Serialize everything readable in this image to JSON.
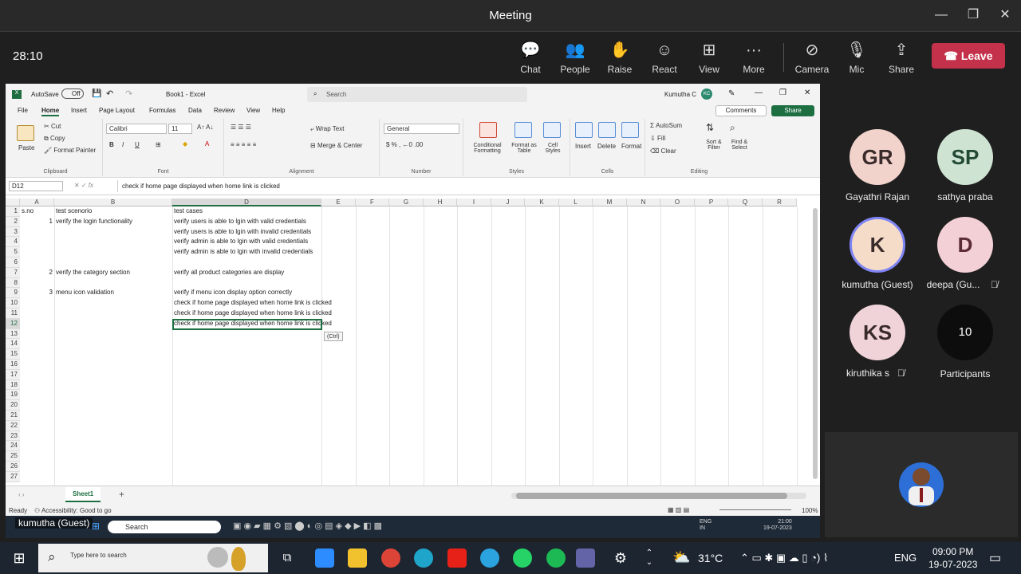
{
  "meeting": {
    "title": "Meeting",
    "timer": "28:10",
    "controls": [
      {
        "label": "Chat",
        "icon": "chat-icon"
      },
      {
        "label": "People",
        "icon": "people-icon"
      },
      {
        "label": "Raise",
        "icon": "raise-hand-icon"
      },
      {
        "label": "React",
        "icon": "react-icon"
      },
      {
        "label": "View",
        "icon": "view-icon"
      },
      {
        "label": "More",
        "icon": "more-icon"
      },
      {
        "label": "Camera",
        "icon": "camera-off-icon"
      },
      {
        "label": "Mic",
        "icon": "mic-off-icon"
      },
      {
        "label": "Share",
        "icon": "share-icon"
      }
    ],
    "leave_label": "Leave",
    "leave_color": "#c4314b"
  },
  "excel": {
    "autosave_label": "AutoSave",
    "autosave_state": "Off",
    "filename": "Book1 - Excel",
    "search_placeholder": "Search",
    "user_name": "Kumutha C",
    "user_initials": "KC",
    "menu": [
      "File",
      "Home",
      "Insert",
      "Page Layout",
      "Formulas",
      "Data",
      "Review",
      "View",
      "Help"
    ],
    "comments_label": "Comments",
    "share_label": "Share",
    "ribbon": {
      "paste": "Paste",
      "cut": "Cut",
      "copy": "Copy",
      "format_painter": "Format Painter",
      "clipboard": "Clipboard",
      "font_name": "Calibri",
      "font_size": "11",
      "font": "Font",
      "wrap_text": "Wrap Text",
      "merge_center": "Merge & Center",
      "alignment": "Alignment",
      "number_format": "General",
      "number": "Number",
      "conditional": "Conditional Formatting",
      "format_table": "Format as Table",
      "cell_styles": "Cell Styles",
      "styles": "Styles",
      "insert": "Insert",
      "delete": "Delete",
      "format": "Format",
      "cells": "Cells",
      "autosum": "AutoSum",
      "fill": "Fill",
      "clear": "Clear",
      "sort_filter": "Sort & Filter",
      "find_select": "Find & Select",
      "editing": "Editing"
    },
    "name_box": "D12",
    "formula": "check if home page displayed when home link is clicked",
    "columns": [
      "A",
      "B",
      "D",
      "E",
      "F",
      "G",
      "H",
      "I",
      "J",
      "K",
      "L",
      "M",
      "N",
      "O",
      "P",
      "Q",
      "R"
    ],
    "rows": [
      "1",
      "2",
      "3",
      "4",
      "5",
      "6",
      "7",
      "8",
      "9",
      "10",
      "11",
      "12",
      "13",
      "14",
      "15",
      "16",
      "17",
      "18",
      "19",
      "20",
      "21",
      "22",
      "23",
      "24",
      "25",
      "26",
      "27"
    ],
    "cells": [
      {
        "r": 1,
        "a": "s.no",
        "b": "test scenorio",
        "d": "test cases"
      },
      {
        "r": 2,
        "a": "1",
        "b": "verify the login functionality",
        "d": "verify users is able to lgin with valid credentials"
      },
      {
        "r": 3,
        "a": "",
        "b": "",
        "d": "verify users is able to lgin with invalid credentials"
      },
      {
        "r": 4,
        "a": "",
        "b": "",
        "d": "verify admin is able to lgin with valid credentials"
      },
      {
        "r": 5,
        "a": "",
        "b": "",
        "d": "verify admin is able to lgin with invalid credentials"
      },
      {
        "r": 7,
        "a": "2",
        "b": "verify the category section",
        "d": "verify all product categories are display"
      },
      {
        "r": 9,
        "a": "3",
        "b": "menu icon validation",
        "d": "verify if menu icon display option correctly"
      },
      {
        "r": 10,
        "a": "",
        "b": "",
        "d": "check if home page displayed when home link is clicked"
      },
      {
        "r": 11,
        "a": "",
        "b": "",
        "d": "check if home page displayed when home link is clicked"
      },
      {
        "r": 12,
        "a": "",
        "b": "",
        "d": "check if home page displayed when home link is clicked"
      }
    ],
    "paste_options": "(Ctrl)",
    "sheet_tab": "Sheet1",
    "status_ready": "Ready",
    "status_accessibility": "Accessibility: Good to go",
    "zoom": "100%"
  },
  "inner_taskbar": {
    "presenter": "kumutha (Guest)",
    "search": "Search",
    "lang": "ENG",
    "region": "IN",
    "time": "21:00",
    "date": "19-07-2023"
  },
  "participants": [
    {
      "initials": "GR",
      "name": "Gayathri Rajan",
      "color": "#f2d3cc",
      "muted": false
    },
    {
      "initials": "SP",
      "name": "sathya praba",
      "color": "#cfe3d3",
      "muted": false
    },
    {
      "initials": "K",
      "name": "kumutha (Guest)",
      "color": "#f5dcc8",
      "muted": false
    },
    {
      "initials": "D",
      "name": "deepa (Gu...",
      "color": "#f3cfd6",
      "muted": true
    },
    {
      "initials": "KS",
      "name": "kiruthika s",
      "color": "#f0d3d8",
      "muted": true
    }
  ],
  "participants_count": "10",
  "participants_label": "Participants",
  "taskbar": {
    "search_placeholder": "Type here to search",
    "weather": "31°C",
    "lang": "ENG",
    "time": "09:00 PM",
    "date": "19-07-2023"
  }
}
